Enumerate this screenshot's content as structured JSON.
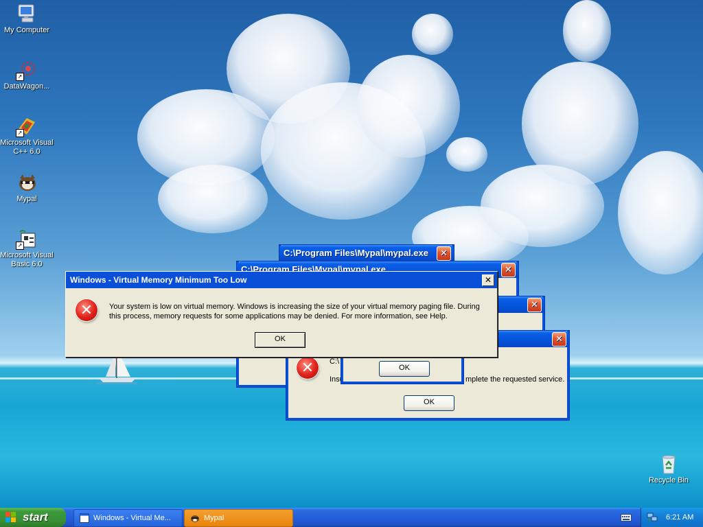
{
  "desktop": {
    "icons": [
      {
        "label": "My Computer",
        "icon": "my-computer-icon"
      },
      {
        "label": "DataWagon...",
        "icon": "datawagon-icon"
      },
      {
        "label": "Microsoft Visual C++ 6.0",
        "label1": "Microsoft Visual",
        "label2": "C++ 6.0",
        "icon": "visual-cpp-icon"
      },
      {
        "label": "Mypal",
        "icon": "mypal-icon"
      },
      {
        "label": "Microsoft Visual Basic 6.0",
        "label1": "Microsoft Visual",
        "label2": "Basic 6.0",
        "icon": "visual-basic-icon"
      },
      {
        "label": "Recycle Bin",
        "icon": "recycle-bin-icon"
      }
    ]
  },
  "dialogs": {
    "mypal_error": {
      "title": "C:\\Program Files\\Mypal\\mypal.exe",
      "close": "✕"
    },
    "back_error_2": {
      "title": "C:\\Program Files\\Mypal\\mypal.exe",
      "close": "✕"
    },
    "back_error_3": {
      "title": "",
      "close": "✕"
    },
    "front_error": {
      "title": "",
      "close": "✕",
      "line1": "C:\\",
      "line2_start": "Insu",
      "line2_end": "mplete the requested service.",
      "ok": "OK"
    },
    "small_popup": {
      "ok": "OK"
    },
    "virtual_memory": {
      "title": "Windows - Virtual Memory Minimum Too Low",
      "close": "✕",
      "message": "Your system is low on virtual memory. Windows is increasing the size of your virtual memory paging file. During this process, memory requests for some applications may be denied. For more information, see Help.",
      "ok": "OK"
    }
  },
  "taskbar": {
    "start_label": "start",
    "tasks": [
      {
        "label": "Windows - Virtual Me...",
        "icon": "window-icon"
      },
      {
        "label": "Mypal",
        "icon": "mypal-icon"
      }
    ],
    "clock": "6:21 AM",
    "tray_icons": [
      "keyboard-icon",
      "network-icon"
    ]
  },
  "colors": {
    "titlebar": "#0553d8",
    "start_green": "#388f34",
    "active_task": "#e8840a",
    "error_red": "#e0201a"
  }
}
